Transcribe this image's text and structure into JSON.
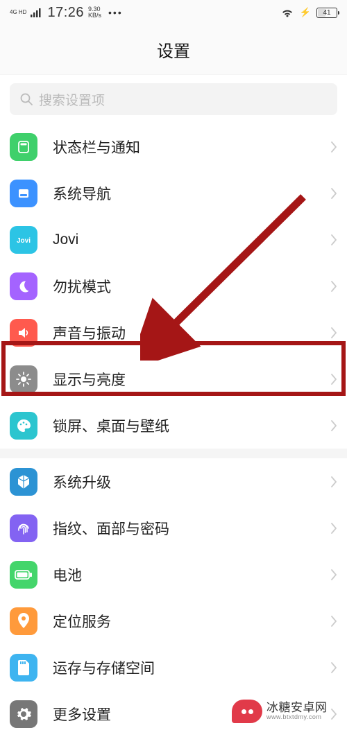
{
  "status": {
    "net_mode": "4G HD",
    "time": "17:26",
    "speed_value": "9.30",
    "speed_unit": "KB/s",
    "battery_percent": "41"
  },
  "header": {
    "title": "设置"
  },
  "search": {
    "placeholder": "搜索设置项"
  },
  "groups": [
    {
      "items": [
        {
          "id": "status-notify",
          "label": "状态栏与通知",
          "color": "c-green",
          "icon": "statusbar"
        },
        {
          "id": "system-nav",
          "label": "系统导航",
          "color": "c-blue",
          "icon": "nav"
        },
        {
          "id": "jovi",
          "label": "Jovi",
          "color": "c-cyan",
          "icon": "jovi"
        },
        {
          "id": "dnd",
          "label": "勿扰模式",
          "color": "c-purple",
          "icon": "moon"
        },
        {
          "id": "sound",
          "label": "声音与振动",
          "color": "c-red",
          "icon": "sound"
        },
        {
          "id": "display",
          "label": "显示与亮度",
          "color": "c-grey",
          "icon": "brightness"
        },
        {
          "id": "lockscreen",
          "label": "锁屏、桌面与壁纸",
          "color": "c-teal",
          "icon": "palette"
        }
      ]
    },
    {
      "items": [
        {
          "id": "system-update",
          "label": "系统升级",
          "color": "c-navy",
          "icon": "cube"
        },
        {
          "id": "biometrics",
          "label": "指纹、面部与密码",
          "color": "c-violet",
          "icon": "finger"
        },
        {
          "id": "battery",
          "label": "电池",
          "color": "c-lime",
          "icon": "battery"
        },
        {
          "id": "location",
          "label": "定位服务",
          "color": "c-orange",
          "icon": "pin"
        },
        {
          "id": "storage",
          "label": "运存与存储空间",
          "color": "c-slate",
          "icon": "sd"
        },
        {
          "id": "more",
          "label": "更多设置",
          "color": "c-dark",
          "icon": "gear"
        }
      ]
    }
  ],
  "watermark": {
    "cn": "冰糖安卓网",
    "en": "www.btxtdmy.com"
  }
}
